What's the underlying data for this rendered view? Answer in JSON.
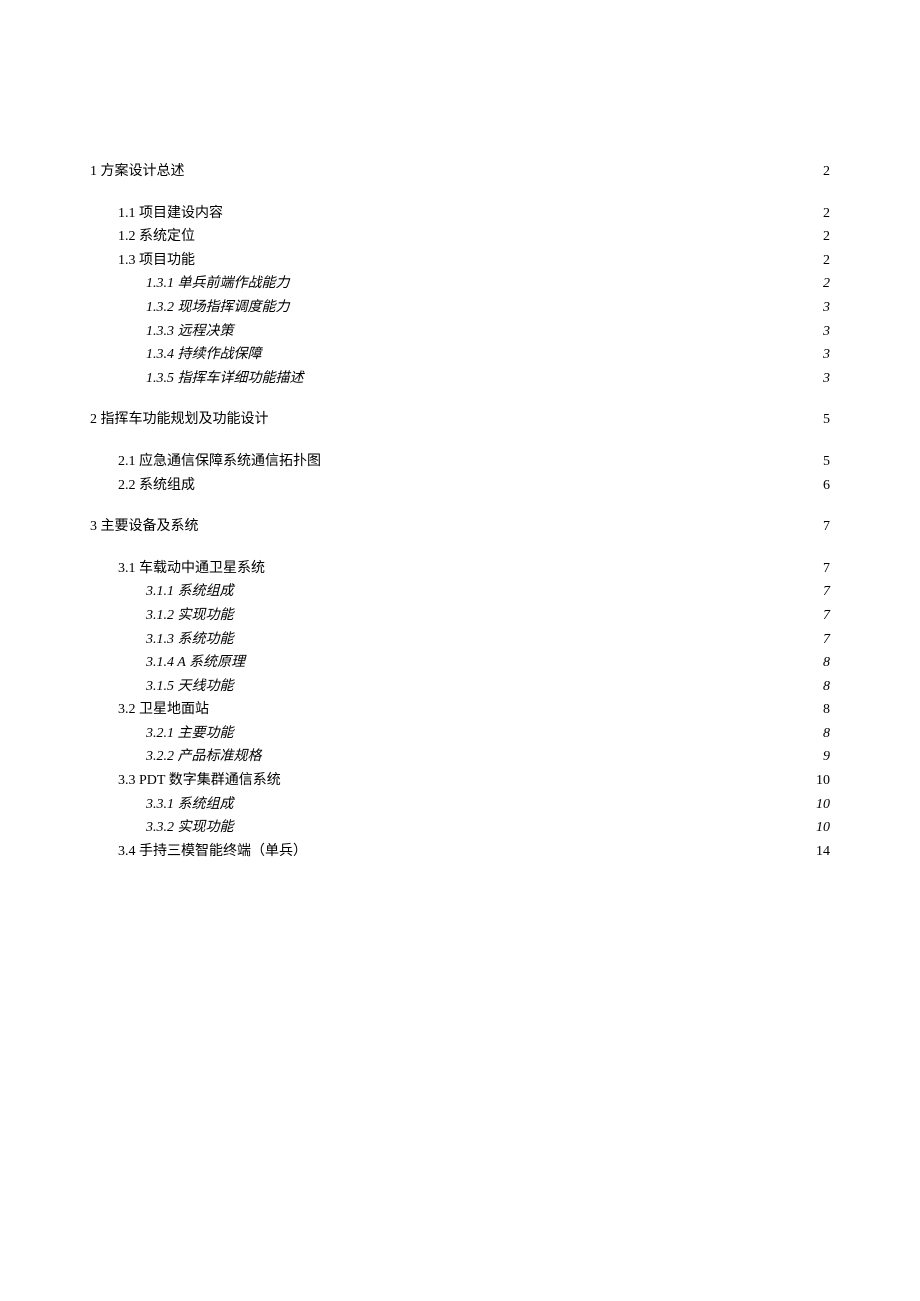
{
  "toc": [
    {
      "level": 1,
      "label": "1 方案设计总述",
      "page": "2"
    },
    {
      "level": 2,
      "label": "1.1  项目建设内容",
      "page": "2"
    },
    {
      "level": 2,
      "label": "1.2  系统定位",
      "page": "2"
    },
    {
      "level": 2,
      "label": "1.3  项目功能",
      "page": "2"
    },
    {
      "level": 3,
      "label": "1.3.1 单兵前端作战能力",
      "page": "2"
    },
    {
      "level": 3,
      "label": "1.3.2 现场指挥调度能力",
      "page": "3"
    },
    {
      "level": 3,
      "label": "1.3.3 远程决策",
      "page": "3"
    },
    {
      "level": 3,
      "label": "1.3.4 持续作战保障",
      "page": "3"
    },
    {
      "level": 3,
      "label": "1.3.5 指挥车详细功能描述",
      "page": "3"
    },
    {
      "level": 1,
      "label": "2 指挥车功能规划及功能设计",
      "page": "5"
    },
    {
      "level": 2,
      "label": "2.1  应急通信保障系统通信拓扑图",
      "page": "5"
    },
    {
      "level": 2,
      "label": "2.2  系统组成",
      "page": "6"
    },
    {
      "level": 1,
      "label": "3 主要设备及系统",
      "page": "7"
    },
    {
      "level": 2,
      "label": "3.1  车载动中通卫星系统",
      "page": "7"
    },
    {
      "level": 3,
      "label": "3.1.1 系统组成",
      "page": "7"
    },
    {
      "level": 3,
      "label": "3.1.2 实现功能",
      "page": "7"
    },
    {
      "level": 3,
      "label": "3.1.3 系统功能",
      "page": "7"
    },
    {
      "level": 3,
      "label": "3.1.4 A 系统原理",
      "page": "8"
    },
    {
      "level": 3,
      "label": "3.1.5 天线功能",
      "page": "8"
    },
    {
      "level": 2,
      "label": "3.2  卫星地面站",
      "page": "8"
    },
    {
      "level": 3,
      "label": "3.2.1 主要功能",
      "page": "8"
    },
    {
      "level": 3,
      "label": "3.2.2 产品标准规格",
      "page": "9"
    },
    {
      "level": 2,
      "label": "3.3  PDT 数字集群通信系统",
      "page": "10"
    },
    {
      "level": 3,
      "label": "3.3.1 系统组成",
      "page": "10"
    },
    {
      "level": 3,
      "label": "3.3.2 实现功能",
      "page": "10"
    },
    {
      "level": 2,
      "label": "3.4  手持三模智能终端（单兵）",
      "page": "14"
    }
  ]
}
